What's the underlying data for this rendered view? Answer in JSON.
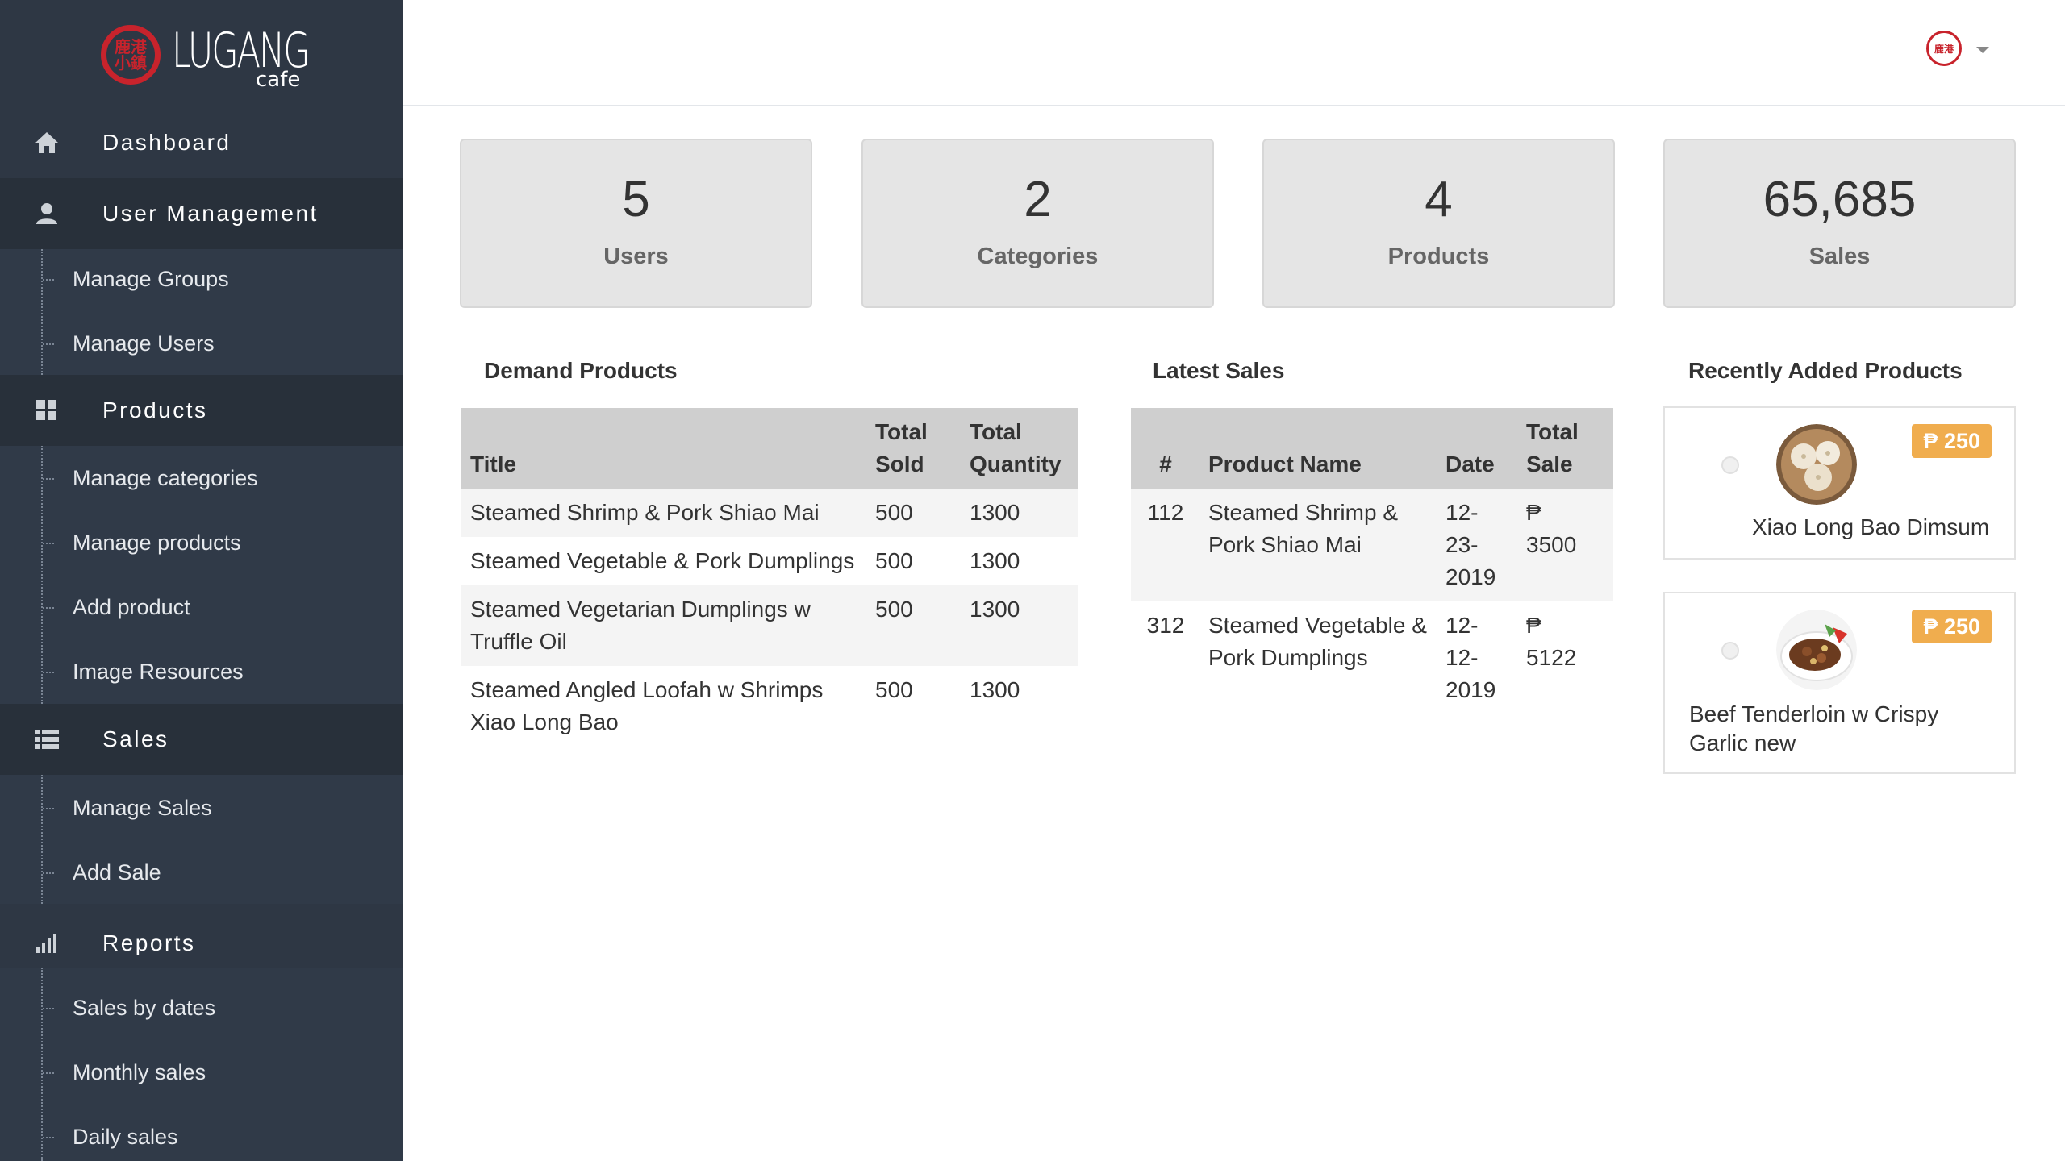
{
  "brand": {
    "name": "LUGANG",
    "sub": "cafe",
    "seal_text": "鹿港小鎮"
  },
  "sidebar": {
    "dashboard": "Dashboard",
    "user_management": {
      "label": "User Management",
      "items": [
        "Manage Groups",
        "Manage Users"
      ]
    },
    "products": {
      "label": "Products",
      "items": [
        "Manage categories",
        "Manage products",
        "Add product",
        "Image Resources"
      ]
    },
    "sales": {
      "label": "Sales",
      "items": [
        "Manage Sales",
        "Add Sale"
      ]
    },
    "reports": {
      "label": "Reports",
      "items": [
        "Sales by dates",
        "Monthly sales",
        "Daily sales"
      ]
    }
  },
  "stats": [
    {
      "value": "5",
      "label": "Users"
    },
    {
      "value": "2",
      "label": "Categories"
    },
    {
      "value": "4",
      "label": "Products"
    },
    {
      "value": "65,685",
      "label": "Sales"
    }
  ],
  "demand_products": {
    "title": "Demand Products",
    "headers": {
      "title": "Title",
      "sold_1": "Total",
      "sold_2": "Sold",
      "qty_1": "Total",
      "qty_2": "Quantity"
    },
    "rows": [
      {
        "title": "Steamed Shrimp & Pork Shiao Mai",
        "sold": "500",
        "qty": "1300"
      },
      {
        "title": "Steamed Vegetable & Pork Dumplings",
        "sold": "500",
        "qty": "1300"
      },
      {
        "title": "Steamed Vegetarian Dumplings w Truffle Oil",
        "sold": "500",
        "qty": "1300"
      },
      {
        "title": "Steamed Angled Loofah w Shrimps Xiao Long Bao",
        "sold": "500",
        "qty": "1300"
      }
    ]
  },
  "latest_sales": {
    "title": "Latest Sales",
    "headers": {
      "num": "#",
      "product": "Product Name",
      "date": "Date",
      "total_1": "Total",
      "total_2": "Sale"
    },
    "rows": [
      {
        "num": "112",
        "product": "Steamed Shrimp & Pork Shiao Mai",
        "date_1": "12-",
        "date_2": "23-",
        "date_3": "2019",
        "currency": "₱",
        "amount": "3500"
      },
      {
        "num": "312",
        "product": "Steamed Vegetable & Pork Dumplings",
        "date_1": "12-",
        "date_2": "12-",
        "date_3": "2019",
        "currency": "₱",
        "amount": "5122"
      }
    ]
  },
  "recent_products": {
    "title": "Recently Added Products",
    "items": [
      {
        "name": "Xiao Long Bao Dimsum",
        "price": "₱ 250"
      },
      {
        "name": "Beef Tenderloin w Crispy Garlic new",
        "price": "₱ 250"
      }
    ]
  },
  "colors": {
    "sidebar": "#2e3744",
    "accent_red": "#c8232c",
    "price_badge": "#f0ad4e"
  }
}
